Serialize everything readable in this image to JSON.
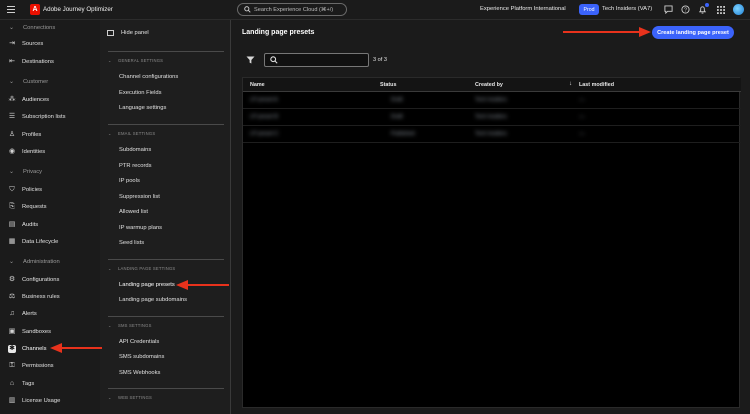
{
  "topbar": {
    "app_title": "Adobe Journey Optimizer",
    "search_placeholder": "Search Experience Cloud (⌘+/)",
    "org_name": "Experience Platform International",
    "env_badge": "Prod",
    "sandbox_name": "Tech Insiders (VA7)"
  },
  "leftnav": {
    "sections": [
      {
        "label": "Connections",
        "items": [
          "Sources",
          "Destinations"
        ]
      },
      {
        "label": "Customer",
        "items": [
          "Audiences",
          "Subscription lists",
          "Profiles",
          "Identities"
        ]
      },
      {
        "label": "Privacy",
        "items": [
          "Policies",
          "Requests",
          "Audits",
          "Data Lifecycle"
        ]
      },
      {
        "label": "Administration",
        "items": [
          "Configurations",
          "Business rules",
          "Alerts",
          "Sandboxes",
          "Channels",
          "Permissions",
          "Tags",
          "License Usage"
        ]
      }
    ],
    "active_item": "Channels"
  },
  "panel": {
    "hide_label": "Hide panel",
    "groups": [
      {
        "title": "GENERAL SETTINGS",
        "items": [
          "Channel configurations",
          "Execution Fields",
          "Language settings"
        ]
      },
      {
        "title": "EMAIL SETTINGS",
        "items": [
          "Subdomains",
          "PTR records",
          "IP pools",
          "Suppression list",
          "Allowed list",
          "IP warmup plans",
          "Seed lists"
        ]
      },
      {
        "title": "LANDING PAGE SETTINGS",
        "items": [
          "Landing page presets",
          "Landing page subdomains"
        ]
      },
      {
        "title": "SMS SETTINGS",
        "items": [
          "API Credentials",
          "SMS subdomains",
          "SMS Webhooks"
        ]
      },
      {
        "title": "WEB SETTINGS",
        "items": []
      }
    ],
    "active_item": "Landing page presets"
  },
  "main": {
    "title": "Landing page presets",
    "create_button": "Create landing page preset",
    "search_value": "",
    "count": "3 of 3",
    "columns": [
      "Name",
      "Status",
      "Created by",
      "Last modified"
    ],
    "rows": [
      [
        "LP preset A",
        "Draft",
        "Tech Insiders",
        "—"
      ],
      [
        "LP preset B",
        "Draft",
        "Tech Insiders",
        "—"
      ],
      [
        "LP preset C",
        "Published",
        "Tech Insiders",
        "—"
      ]
    ]
  },
  "colors": {
    "accent": "#3b63fb",
    "background": "#1b1b1b",
    "table_bg": "#000000",
    "adobe_red": "#eb1000"
  }
}
